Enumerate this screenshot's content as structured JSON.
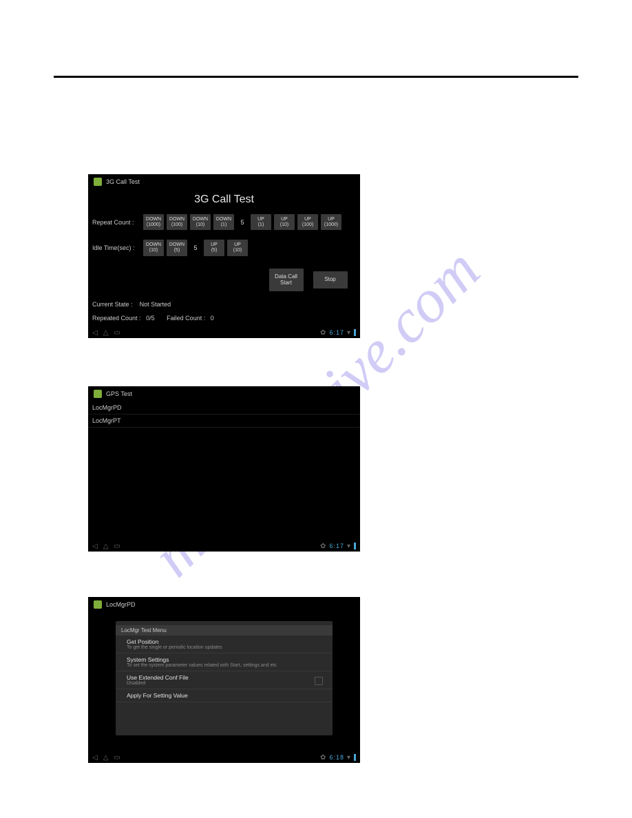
{
  "watermark": "manualshive.com",
  "tablet1": {
    "app_title": "3G Call Test",
    "screen_title": "3G Call Test",
    "repeat_label": "Repeat Count :",
    "repeat_down": [
      "DOWN\n(1000)",
      "DOWN\n(100)",
      "DOWN\n(10)",
      "DOWN\n(1)"
    ],
    "repeat_value": "5",
    "repeat_up": [
      "UP\n(1)",
      "UP\n(10)",
      "UP\n(100)",
      "UP\n(1000)"
    ],
    "idle_label": "Idle Time(sec) :",
    "idle_down": [
      "DOWN\n(10)",
      "DOWN\n(5)"
    ],
    "idle_value": "5",
    "idle_up": [
      "UP\n(5)",
      "UP\n(10)"
    ],
    "btn_start": "Data Call\nStart",
    "btn_stop": "Stop",
    "state_label": "Current State :",
    "state_value": "Not Started",
    "repcount_label": "Repeated Count :",
    "repcount_value": "0/5",
    "failcount_label": "Failed Count :",
    "failcount_value": "0",
    "clock": "6:17"
  },
  "tablet2": {
    "app_title": "GPS Test",
    "items": [
      "LocMgrPD",
      "LocMgrPT"
    ],
    "clock": "6:17"
  },
  "tablet3": {
    "app_title": "LocMgrPD",
    "panel_head": "LocMgr Test Menu",
    "items": [
      {
        "title": "Get Position",
        "sub": "To get the single or periodic location updates"
      },
      {
        "title": "System Settings",
        "sub": "To set the system parameter values related with Start, settings and etc"
      },
      {
        "title": "Use Extended Conf File",
        "sub": "Disabled",
        "check": true
      },
      {
        "title": "Apply For Setting Value",
        "sub": ""
      }
    ],
    "clock": "6:18"
  }
}
